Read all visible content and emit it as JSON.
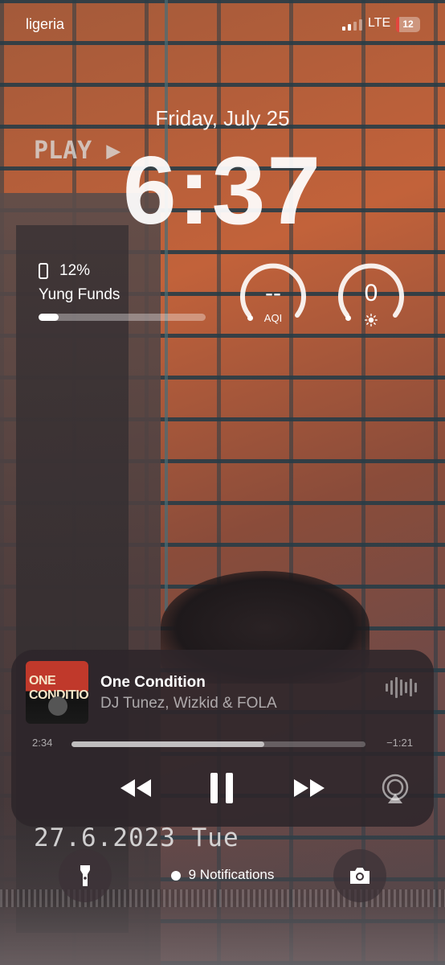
{
  "status_bar": {
    "carrier": "ligeria",
    "network": "LTE",
    "battery": "12",
    "battery_level": 0.12,
    "battery_color": "#e2463d"
  },
  "lock_screen": {
    "date": "Friday, July 25",
    "time": "6:37",
    "wallpaper_text_top": "PLAY ▶",
    "wallpaper_text_bottom": "27.6.2023 Tue"
  },
  "widgets": {
    "battery_widget": {
      "icon": "phone-icon",
      "percent": "12%",
      "device": "Yung Funds",
      "level": 0.12
    },
    "aqi_gauge": {
      "value": "--",
      "label": "AQI"
    },
    "uv_gauge": {
      "value": "0",
      "icon": "sun-icon"
    }
  },
  "now_playing": {
    "artwork_text": "ONE CONDITION",
    "title": "One Condition",
    "artist": "DJ Tunez, Wizkid & FOLA",
    "elapsed": "2:34",
    "remaining": "−1:21",
    "progress": 0.656,
    "controls": {
      "rewind": "rewind-icon",
      "pause": "pause-icon",
      "fast_forward": "fast-forward-icon",
      "airplay": "airplay-icon"
    }
  },
  "bottom_bar": {
    "flashlight": "flashlight-icon",
    "notifications": "9 Notifications",
    "camera": "camera-icon"
  }
}
